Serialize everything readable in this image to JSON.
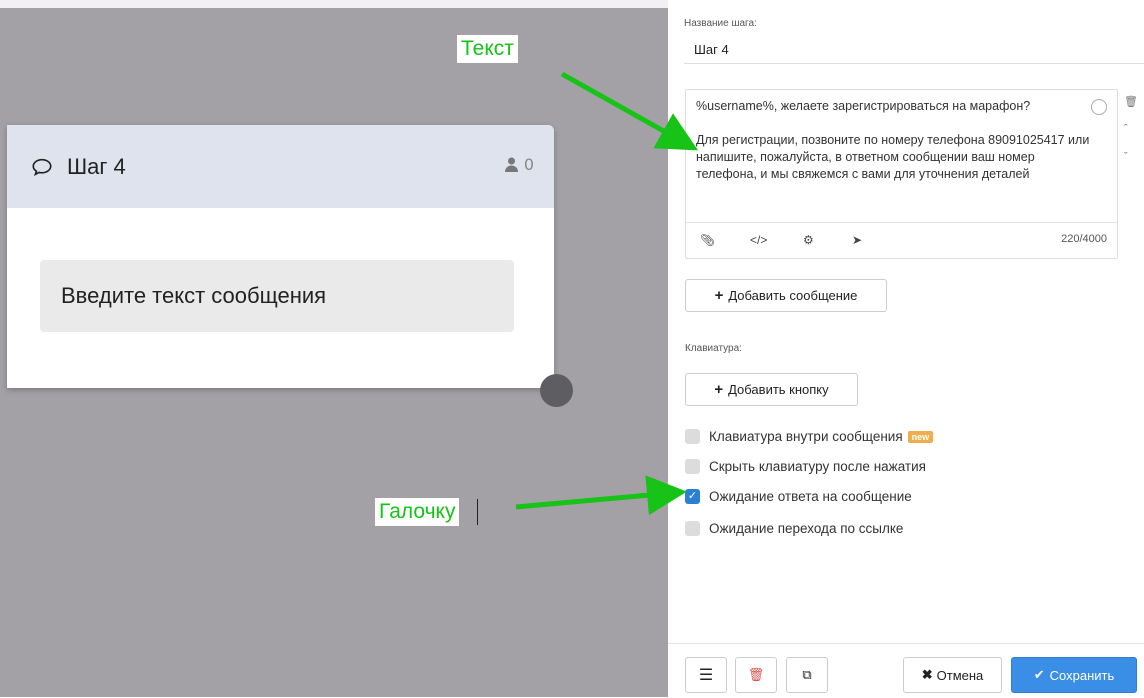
{
  "annotations": {
    "text_label": "Текст",
    "check_label": "Галочку"
  },
  "card": {
    "title": "Шаг 4",
    "user_count": "0",
    "message_placeholder": "Введите текст сообщения"
  },
  "panel": {
    "step_name_label": "Название шага:",
    "step_name_value": "Шаг 4",
    "message_text": "%username%, желаете зарегистрироваться на марафон?\n\nДля регистрации, позвоните по номеру телефона 89091025417 или напишите, пожалуйста, в ответном сообщении ваш номер телефона, и мы свяжемся с вами для уточнения деталей",
    "char_counter": "220/4000",
    "add_message_label": "Добавить сообщение",
    "keyboard_label": "Клавиатура:",
    "add_button_label": "Добавить кнопку",
    "checkboxes": [
      {
        "label": "Клавиатура внутри сообщения",
        "checked": false,
        "badge": "new"
      },
      {
        "label": "Скрыть клавиатуру после нажатия",
        "checked": false
      },
      {
        "label": "Ожидание ответа на сообщение",
        "checked": true
      },
      {
        "label": "Ожидание перехода по ссылке",
        "checked": false
      }
    ],
    "cancel_label": "Отмена",
    "save_label": "Сохранить",
    "accent_color": "#2d7fd3",
    "annotation_color": "#16c316"
  }
}
